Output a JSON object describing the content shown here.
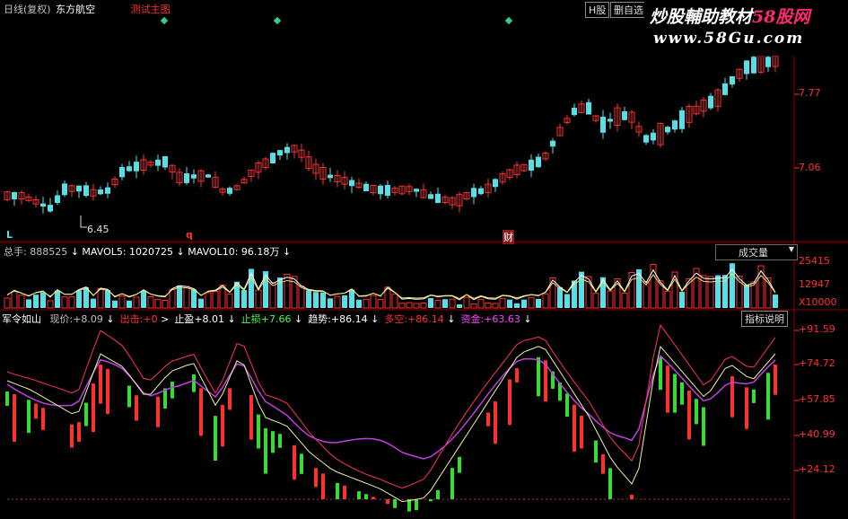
{
  "header": {
    "period_label": "日线(复权)",
    "stock_name": "东方航空",
    "template_label": "测试主图",
    "h_share_button": "H股",
    "self_select_button": "删自选"
  },
  "watermark": {
    "line1_prefix": "炒股輔助教材",
    "line1_brand": "58股网",
    "line2": "www.58Gu.com"
  },
  "price_axis": {
    "labels": [
      "7.77",
      "7.06"
    ]
  },
  "price_marks": {
    "low_label": "6.45",
    "l_marker": "L",
    "q_marker": "q",
    "cai_marker": "财"
  },
  "volume_panel": {
    "total_label": "总手: 888525",
    "mavol5_label": "MAVOL5: 1020725",
    "mavol10_label": "MAVOL10: 96.18万",
    "selector": "成交量",
    "axis_labels": [
      "25415",
      "12947",
      "X10000"
    ]
  },
  "indicator_panel": {
    "name": "军令如山",
    "items": [
      {
        "label": "现价:",
        "value": "+8.09",
        "color": "#c0c0c0"
      },
      {
        "label": "出击:",
        "value": "+0",
        "color": "#ff3030"
      },
      {
        "label": "止盈",
        "value": "+8.01",
        "color": "#ffffff"
      },
      {
        "label": "止损",
        "value": "+7.66",
        "color": "#44ff44"
      },
      {
        "label": "趋势:",
        "value": "+86.14",
        "color": "#ffffff"
      },
      {
        "label": "多空:",
        "value": "+86.14",
        "color": "#ff3030"
      },
      {
        "label": "资金:",
        "value": "+63.63",
        "color": "#ff44ff"
      }
    ],
    "help_button": "指标说明",
    "axis_labels": [
      "+91.59",
      "+74.72",
      "+57.85",
      "+40.99",
      "+24.12"
    ]
  },
  "colors": {
    "up": "#ff3030",
    "down": "#55e0e8",
    "grid": "#8b0000",
    "axis": "#c03030"
  }
}
